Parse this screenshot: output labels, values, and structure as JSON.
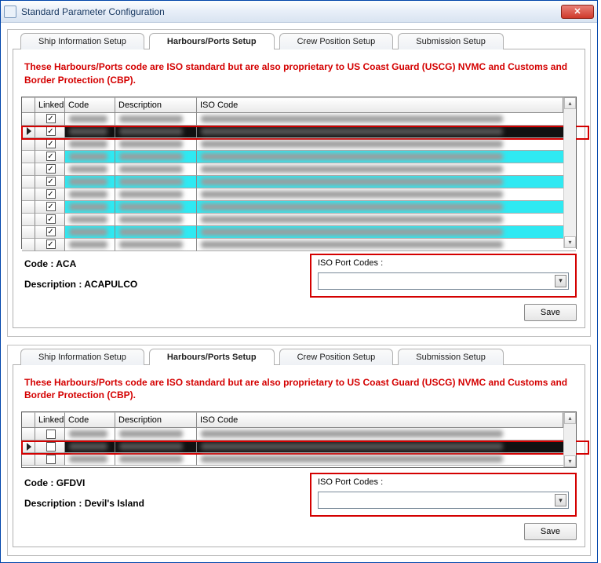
{
  "window": {
    "title": "Standard Parameter Configuration"
  },
  "tabs": {
    "t0": "Ship Information Setup",
    "t1": "Harbours/Ports Setup",
    "t2": "Crew Position Setup",
    "t3": "Submission Setup"
  },
  "warning": "These Harbours/Ports code are ISO standard but are also proprietary to US Coast Guard (USCG) NVMC and Customs and Border Protection (CBP).",
  "grid_headers": {
    "linked": "Linked",
    "code": "Code",
    "desc": "Description",
    "iso": "ISO Code"
  },
  "panel_top": {
    "rows": [
      {
        "linked": true,
        "selected": false
      },
      {
        "linked": true,
        "selected": true
      },
      {
        "linked": true,
        "selected": false
      },
      {
        "linked": true,
        "selected": false
      },
      {
        "linked": true,
        "selected": false
      },
      {
        "linked": true,
        "selected": false
      },
      {
        "linked": true,
        "selected": false
      },
      {
        "linked": true,
        "selected": false
      },
      {
        "linked": true,
        "selected": false
      },
      {
        "linked": true,
        "selected": false
      },
      {
        "linked": true,
        "selected": false
      }
    ],
    "code_label": "Code :",
    "code_value": "ACA",
    "desc_label": "Description :",
    "desc_value": "ACAPULCO",
    "iso_port_label": "ISO Port Codes :",
    "iso_port_value": "",
    "save": "Save"
  },
  "panel_bottom": {
    "rows": [
      {
        "linked": false,
        "selected": false
      },
      {
        "linked": false,
        "selected": true
      },
      {
        "linked": false,
        "selected": false
      }
    ],
    "code_label": "Code :",
    "code_value": "GFDVI",
    "desc_label": "Description :",
    "desc_value": "Devil's Island",
    "iso_port_label": "ISO Port Codes :",
    "iso_port_value": "",
    "save": "Save"
  }
}
